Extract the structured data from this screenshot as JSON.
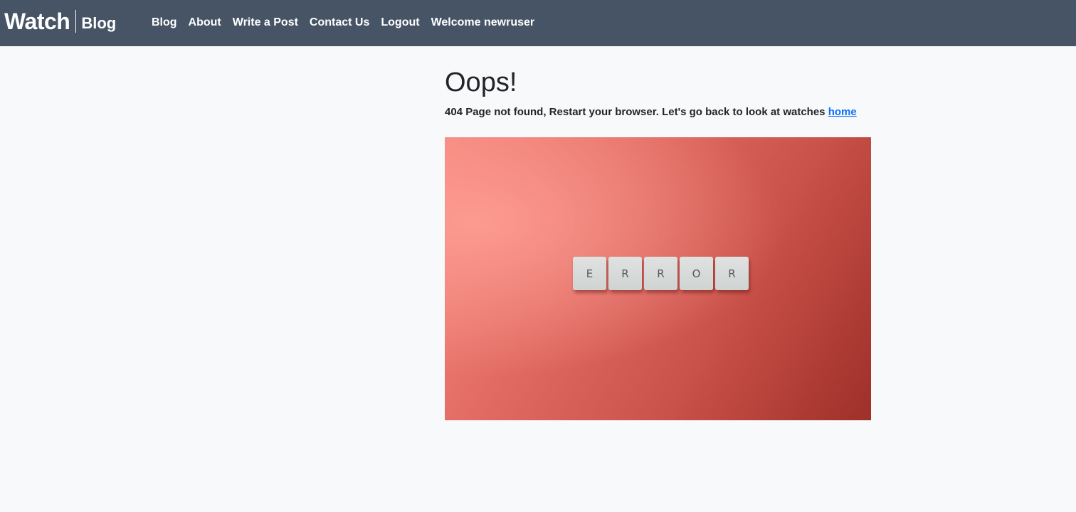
{
  "navbar": {
    "brand_main": "Watch",
    "brand_sub": "Blog",
    "links": [
      "Blog",
      "About",
      "Write a Post",
      "Contact Us",
      "Logout",
      "Welcome newruser"
    ],
    "background": "#475466"
  },
  "main": {
    "title": "Oops!",
    "message": "404 Page not found, Restart your browser. Let's go back to look at watches",
    "home_link": "home"
  },
  "image": {
    "tiles": [
      "E",
      "R",
      "R",
      "O",
      "R"
    ]
  }
}
